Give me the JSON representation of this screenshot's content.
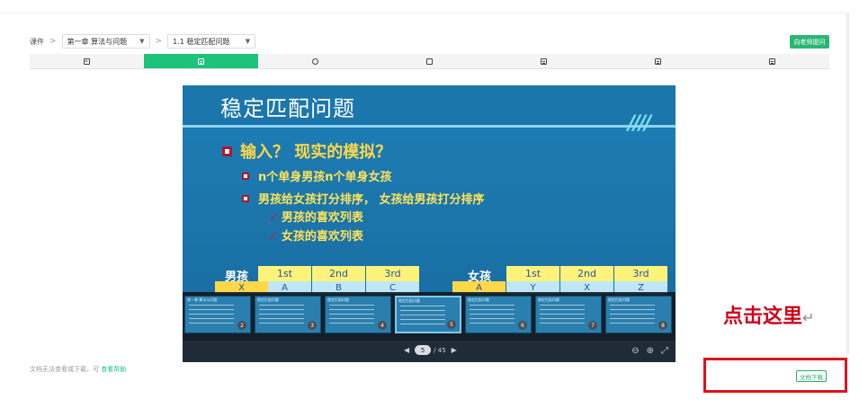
{
  "breadcrumb": {
    "root": "课件",
    "separator": ">",
    "chapter_select": "第一章 算法与问题",
    "section_select": "1.1 稳定匹配问题"
  },
  "ask_teacher_button": "向老师提问",
  "tabs": [
    {
      "icon": "play-icon",
      "active": false
    },
    {
      "icon": "slides-icon",
      "active": true
    },
    {
      "icon": "chat-icon",
      "active": false
    },
    {
      "icon": "edit-icon",
      "active": false
    },
    {
      "icon": "document-icon",
      "active": false
    },
    {
      "icon": "document-icon",
      "active": false
    },
    {
      "icon": "document-icon",
      "active": false
    }
  ],
  "slide": {
    "title": "稳定匹配问题",
    "main_bullet": "输入？  现实的模拟？",
    "sub_bullets": [
      "n个单身男孩n个单身女孩",
      "男孩给女孩打分排序， 女孩给男孩打分排序"
    ],
    "checks": [
      "男孩的喜欢列表",
      "女孩的喜欢列表"
    ],
    "boys_label": "男孩",
    "girls_label": "女孩",
    "boys_headers": [
      "1st",
      "2nd",
      "3rd"
    ],
    "girls_headers": [
      "1st",
      "2nd",
      "3rd"
    ],
    "boys_row": {
      "name": "X",
      "values": [
        "A",
        "B",
        "C"
      ]
    },
    "girls_row": {
      "name": "A",
      "values": [
        "Y",
        "X",
        "Z"
      ]
    }
  },
  "thumbnails": [
    {
      "title": "第一章 算法与问题",
      "num": "2"
    },
    {
      "title": "稳定匹配问题",
      "num": "3"
    },
    {
      "title": "稳定匹配问题",
      "num": "4"
    },
    {
      "title": "稳定匹配问题",
      "num": "5"
    },
    {
      "title": "稳定匹配问题",
      "num": "6"
    },
    {
      "title": "稳定匹配问题",
      "num": "7"
    },
    {
      "title": "稳定匹配问题",
      "num": "8"
    }
  ],
  "pager": {
    "current": "5",
    "total": "/ 45",
    "prev": "◀",
    "next": "▶"
  },
  "viewer_controls": {
    "zoom_out": "⊖",
    "zoom_in": "⊕",
    "fullscreen": "⤢"
  },
  "annotation": {
    "text": "点击这里",
    "mark": "↵"
  },
  "bottom_note": {
    "text": "文档无法查看或下载，可 ",
    "link": "查看帮助"
  },
  "download_button": "文档下载",
  "colors": {
    "accent": "#1dc27b",
    "highlight": "#e0131b",
    "slide_bg": "#1d7fb6"
  }
}
